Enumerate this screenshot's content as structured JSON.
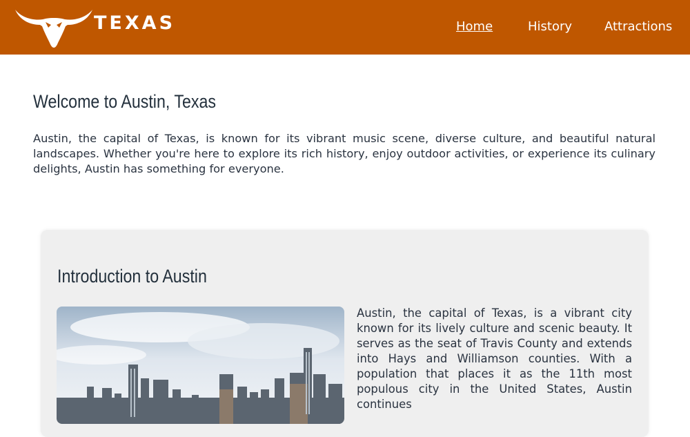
{
  "header": {
    "brand_text": "TEXAS",
    "logo_icon": "longhorn-icon",
    "background_color": "#bf5700",
    "nav": [
      {
        "label": "Home",
        "active": true
      },
      {
        "label": "History",
        "active": false
      },
      {
        "label": "Attractions",
        "active": false
      }
    ]
  },
  "welcome": {
    "title": "Welcome to Austin, Texas",
    "text": "Austin, the capital of Texas, is known for its vibrant music scene, diverse culture, and beautiful natural landscapes. Whether you're here to explore its rich history, enjoy outdoor activities, or experience its culinary delights, Austin has something for everyone."
  },
  "intro": {
    "title": "Introduction to Austin",
    "image": "austin-skyline-photo",
    "text": "Austin, the capital of Texas, is a vibrant city known for its lively culture and scenic beauty. It serves as the seat of Travis County and extends into Hays and Williamson counties. With a population that places it as the 11th most populous city in the United States, Austin continues"
  }
}
